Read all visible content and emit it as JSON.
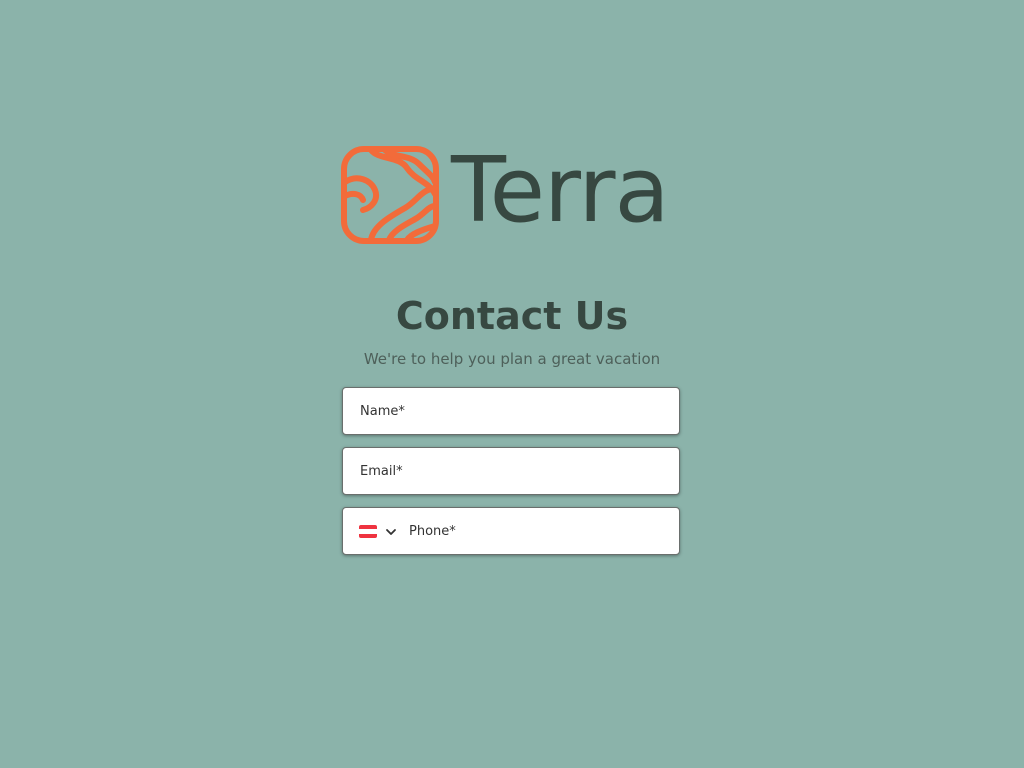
{
  "brand": {
    "name": "Terra",
    "mark_color": "#f26b3a",
    "text_color": "#374841"
  },
  "page": {
    "background": "#8bb3aa",
    "title": "Contact Us",
    "subtitle": "We're to help you plan a great vacation"
  },
  "form": {
    "name_placeholder": "Name*",
    "email_placeholder": "Email*",
    "phone_placeholder": "Phone*",
    "country": {
      "icon": "flag-icon",
      "flag_colors": [
        "#ef3340",
        "#ffffff",
        "#ef3340"
      ],
      "chevron_icon": "chevron-down-icon"
    }
  }
}
